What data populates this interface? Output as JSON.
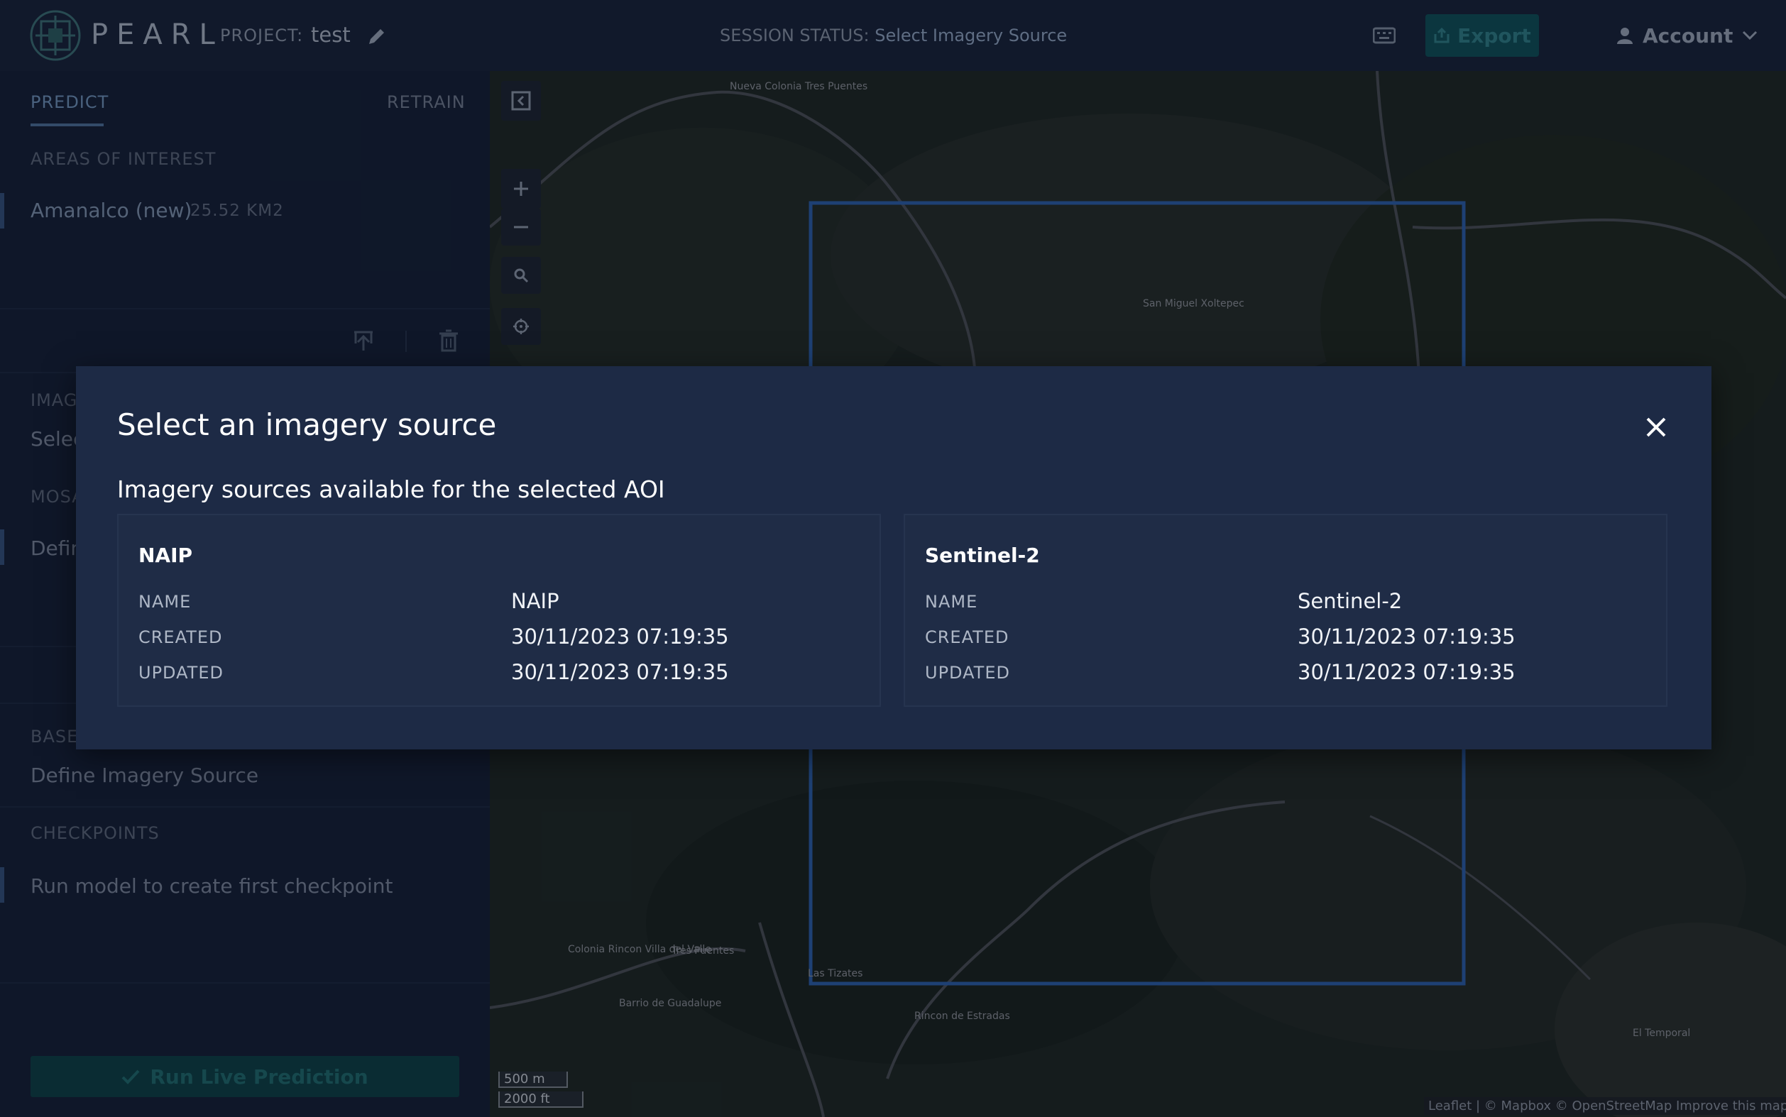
{
  "header": {
    "logo_text": "PEARL",
    "project_label": "PROJECT:",
    "project_name": "test",
    "session_label": "SESSION STATUS:",
    "session_value": "Select Imagery Source",
    "export_label": "Export",
    "account_label": "Account"
  },
  "sidebar": {
    "tabs": [
      {
        "label": "PREDICT"
      },
      {
        "label": "RETRAIN"
      }
    ],
    "aoi_section": "AREAS OF INTEREST",
    "aoi_name": "Amanalco (new)",
    "aoi_area": "25.52 KM2",
    "imagery_section": "IMAGERY",
    "imagery_value": "Select Imagery Source",
    "mosaic_section": "MOSAIC",
    "mosaic_value": "Define Mosaic",
    "base_section": "BASE MODEL",
    "base_value": "Define Imagery Source",
    "checkpoints_section": "CHECKPOINTS",
    "checkpoints_value": "Run model to create first checkpoint",
    "run_button": "Run Live Prediction"
  },
  "map": {
    "scale_metric": "500 m",
    "scale_imperial": "2000 ft",
    "attribution": "Leaflet | © Mapbox © OpenStreetMap Improve this map",
    "labels": [
      "Nueva Colonia Tres Puentes",
      "San Miguel Xoltepec",
      "Colonia Rincon Villa del Valle",
      "Tres Puentes",
      "Las Tizates",
      "Barrio de Guadalupe",
      "Rincon de Estradas",
      "El Temporal"
    ]
  },
  "modal": {
    "title": "Select an imagery source",
    "subtitle": "Imagery sources available for the selected AOI",
    "sources": [
      {
        "title": "NAIP",
        "name_label": "NAME",
        "name": "NAIP",
        "created_label": "CREATED",
        "created": "30/11/2023 07:19:35",
        "updated_label": "UPDATED",
        "updated": "30/11/2023 07:19:35"
      },
      {
        "title": "Sentinel-2",
        "name_label": "NAME",
        "name": "Sentinel-2",
        "created_label": "CREATED",
        "created": "30/11/2023 07:19:35",
        "updated_label": "UPDATED",
        "updated": "30/11/2023 07:19:35"
      }
    ]
  },
  "colors": {
    "background": "#101828",
    "modal": "#1d2a45",
    "accent_teal": "#0f4f57",
    "aoi_box": "#2b5fa8"
  }
}
